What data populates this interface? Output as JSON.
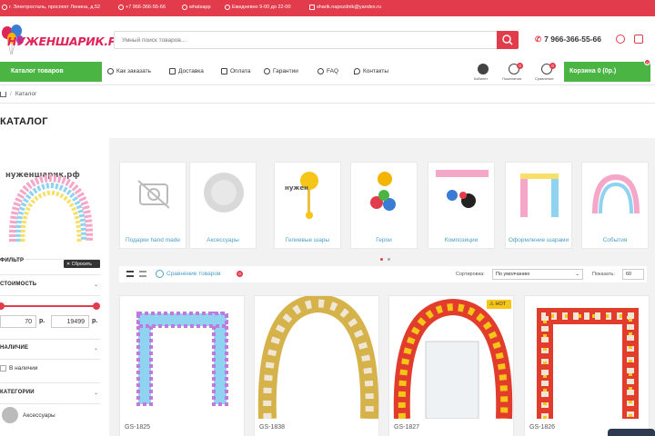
{
  "topbar": {
    "address": "г. Электросталь, проспект Ленина, д.52",
    "phone": "+7 966-366-55-66",
    "whatsapp": "whatsapp",
    "hours": "Ежедневно 9-00 до 22-00",
    "email": "sharik.napozdnik@yandex.ru"
  },
  "logo": {
    "text": "НУЖЕНШАРИК.РФ"
  },
  "search": {
    "placeholder": "Умный поиск товаров..."
  },
  "header": {
    "phone": "7 966-366-55-66"
  },
  "nav": {
    "catalog_label": "Каталог товаров",
    "items": [
      "Как заказать",
      "Доставка",
      "Оплата",
      "Гарантии",
      "FAQ",
      "Контакты"
    ]
  },
  "user": {
    "cabinet": "Кабинет",
    "wishlist": "Пожелания",
    "wishlist_count": "0",
    "compare": "Сравнение",
    "compare_count": "0",
    "cart_label": "Корзина 0 (0р.)",
    "cart_count": "0"
  },
  "breadcrumb": {
    "current": "Каталог"
  },
  "page": {
    "title": "КАТАЛОГ"
  },
  "sidebar": {
    "arch_logo": "нужен­шарик.рф",
    "filter_title": "ФИЛЬТР",
    "reset_label": "Сбросить",
    "price_title": "СТОИМОСТЬ",
    "price_min": "70",
    "price_max": "19499",
    "currency": "р.",
    "stock_title": "НАЛИЧИЕ",
    "in_stock_label": "В наличии",
    "categories_title": "КАТЕГОРИИ",
    "category_first": "Аксессуары"
  },
  "categories": [
    {
      "label": "Подарки hand made"
    },
    {
      "label": "Аксессуары"
    },
    {
      "label": "Гелиевые шары"
    },
    {
      "label": "Герои"
    },
    {
      "label": "Композиции"
    },
    {
      "label": "Оформление шарами"
    },
    {
      "label": "События"
    }
  ],
  "toolbar": {
    "compare_label": "Сравнение товаров",
    "compare_count": "0",
    "sort_label": "Сортировка:",
    "sort_value": "По умолчанию",
    "show_label": "Показать:",
    "show_value": "60"
  },
  "products": [
    {
      "code": "GS-1825"
    },
    {
      "code": "GS-1838"
    },
    {
      "code": "GS-1827",
      "badge": "HOT"
    },
    {
      "code": "GS-1826"
    }
  ],
  "colors": {
    "accent": "#e23c4c",
    "green": "#4bb543",
    "link": "#4aa0c8"
  }
}
